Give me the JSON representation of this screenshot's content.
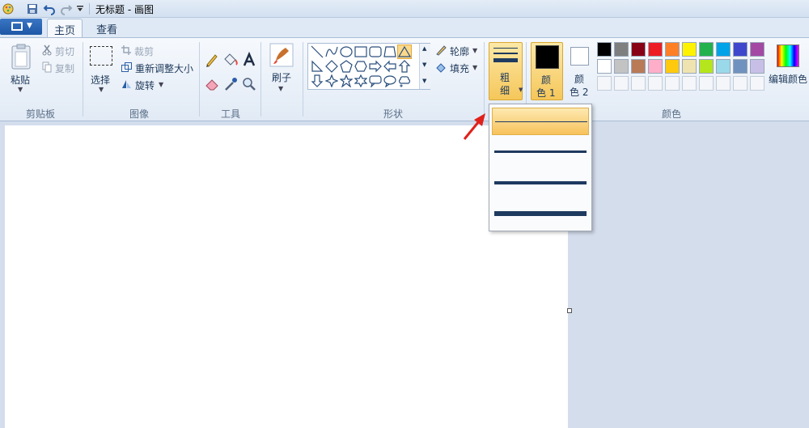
{
  "window": {
    "title": "无标题 - 画图"
  },
  "tabs": [
    {
      "label": "主页"
    },
    {
      "label": "查看"
    }
  ],
  "clipboard": {
    "paste": "粘贴",
    "cut": "剪切",
    "copy": "复制",
    "group": "剪贴板"
  },
  "image": {
    "select": "选择",
    "crop": "裁剪",
    "resize": "重新调整大小",
    "rotate": "旋转",
    "group": "图像"
  },
  "tools": {
    "group": "工具"
  },
  "brushes": {
    "label": "刷子"
  },
  "shapes": {
    "outline": "轮廓",
    "fill": "填充",
    "group": "形状"
  },
  "size": {
    "label_top": "粗",
    "label_bottom": "细"
  },
  "colors": {
    "color1_top": "颜",
    "color1_bottom": "色 1",
    "color2_top": "颜",
    "color2_bottom": "色 2",
    "edit": "编辑颜色",
    "group": "颜色",
    "primary": "#000000",
    "secondary": "#ffffff",
    "row1": [
      "#000000",
      "#7f7f7f",
      "#880015",
      "#ed1c24",
      "#ff7f27",
      "#fff200",
      "#22b14c",
      "#00a2e8",
      "#3f48cc",
      "#a349a4"
    ],
    "row2": [
      "#ffffff",
      "#c3c3c3",
      "#b97a57",
      "#ffaec9",
      "#ffc90e",
      "#efe4b0",
      "#b5e61d",
      "#99d9ea",
      "#7092be",
      "#c8bfe7"
    ]
  },
  "size_menu": {
    "options": [
      "1px",
      "3px",
      "5px",
      "8px"
    ],
    "selected": 0
  }
}
